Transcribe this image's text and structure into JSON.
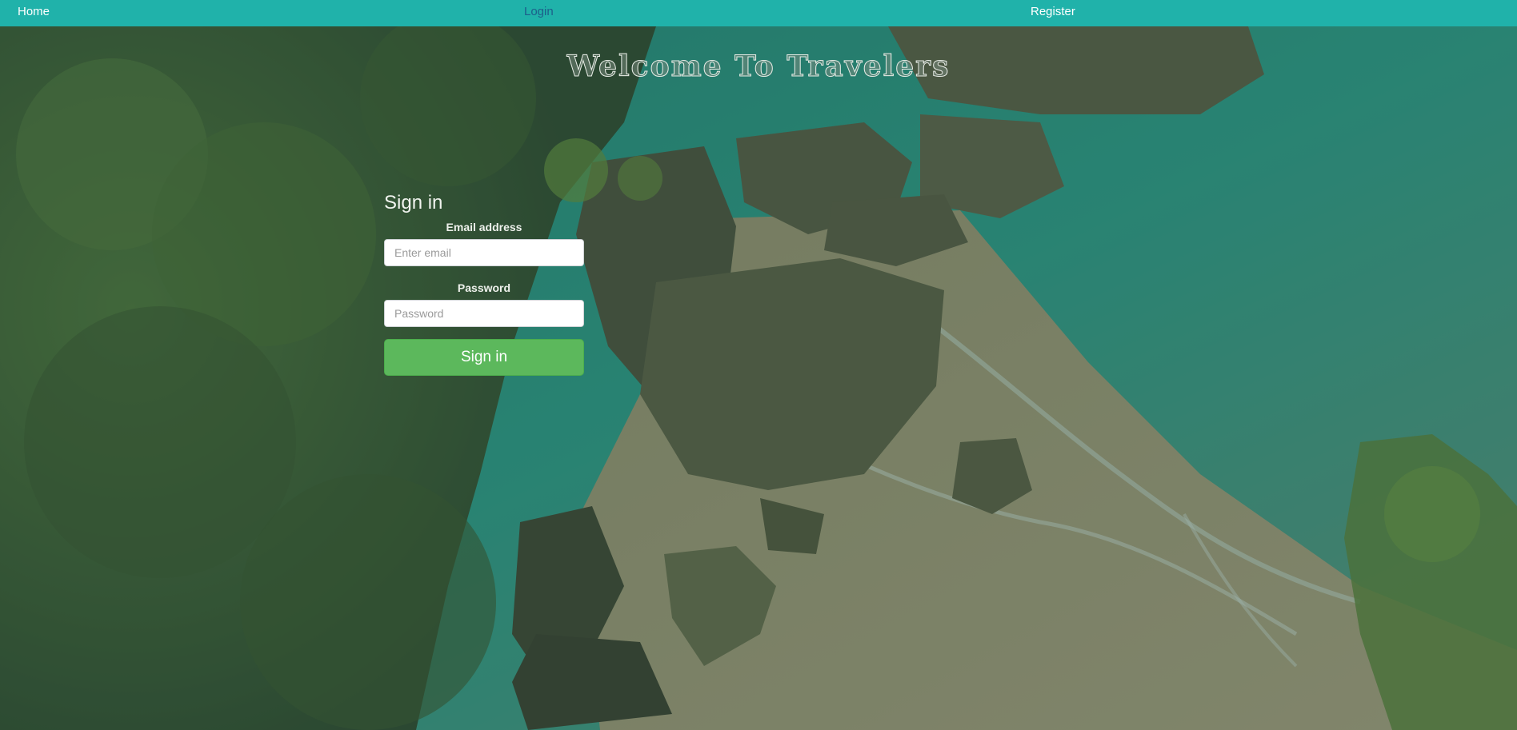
{
  "nav": {
    "home_label": "Home",
    "login_label": "Login",
    "register_label": "Register",
    "bar_color": "#20b2aa",
    "active_link_color": "#1d5e8a"
  },
  "hero": {
    "title": "Welcome To Travelers"
  },
  "signin_form": {
    "heading": "Sign in",
    "email_label": "Email address",
    "email_placeholder": "Enter email",
    "email_value": "",
    "password_label": "Password",
    "password_placeholder": "Password",
    "password_value": "",
    "submit_label": "Sign in",
    "submit_color": "#5cb85c"
  },
  "background": {
    "image": "coastal-beach-rocks-jungle-photo"
  }
}
